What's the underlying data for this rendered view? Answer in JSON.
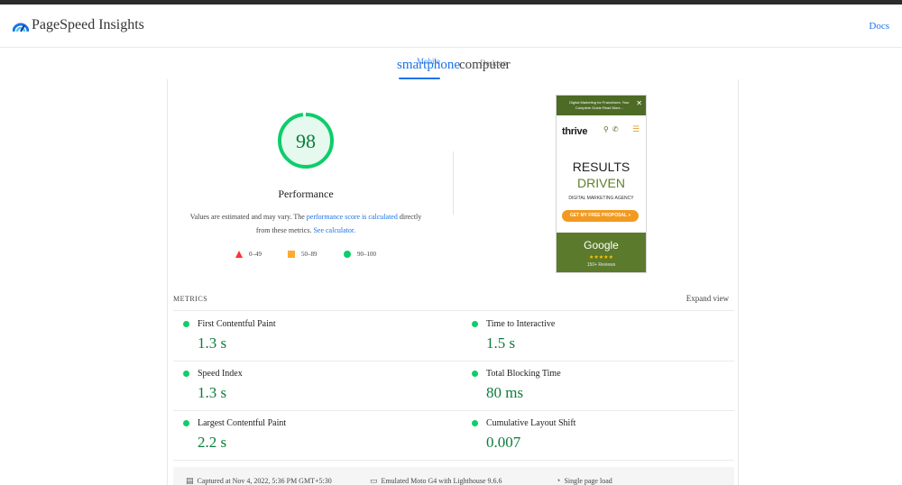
{
  "app": {
    "title": "PageSpeed Insights",
    "docs_label": "Docs"
  },
  "tabs": {
    "mobile": {
      "label": "smartphone",
      "sub_label": "Mobile"
    },
    "desktop": {
      "label": "computer",
      "sub_label": "Desktop"
    }
  },
  "performance": {
    "score": "98",
    "title": "Performance",
    "note_prefix": "Values are estimated and may vary. The ",
    "note_link1": "performance score is calculated",
    "note_mid": " directly from these metrics. ",
    "note_link2": "See calculator."
  },
  "legend": [
    {
      "label": "0–49",
      "shape": "triangle",
      "color": "#ff3333"
    },
    {
      "label": "50–89",
      "shape": "square",
      "color": "#ffaa33"
    },
    {
      "label": "90–100",
      "shape": "circle",
      "color": "#0cce6b"
    }
  ],
  "screenshot": {
    "banner": "Digital Marketing for Franchises: Your Complete Guide Read More...",
    "logo": "thrive",
    "heading1": "RESULTS",
    "heading2": "DRIVEN",
    "subheading": "DIGITAL MARKETING AGENCY",
    "button": "GET MY FREE PROPOSAL »",
    "google": "Google",
    "stars": "★★★★★",
    "reviews": "150+ Reviews"
  },
  "metrics_section": {
    "heading": "METRICS",
    "expand_label": "Expand view"
  },
  "metrics": [
    {
      "name": "First Contentful Paint",
      "value": "1.3 s",
      "status": "good"
    },
    {
      "name": "Time to Interactive",
      "value": "1.5 s",
      "status": "good"
    },
    {
      "name": "Speed Index",
      "value": "1.3 s",
      "status": "good"
    },
    {
      "name": "Total Blocking Time",
      "value": "80 ms",
      "status": "good"
    },
    {
      "name": "Largest Contentful Paint",
      "value": "2.2 s",
      "status": "good"
    },
    {
      "name": "Cumulative Layout Shift",
      "value": "0.007",
      "status": "good"
    }
  ],
  "footer": {
    "captured": "Captured at Nov 4, 2022, 5:36 PM GMT+5:30",
    "device": "Emulated Moto G4 with Lighthouse 9.6.6",
    "load": "Single page load"
  },
  "colors": {
    "accent": "#1a73e8",
    "good": "#0cce6b",
    "good_text": "#0c7d3c",
    "average": "#ffaa33",
    "poor": "#ff3333"
  }
}
